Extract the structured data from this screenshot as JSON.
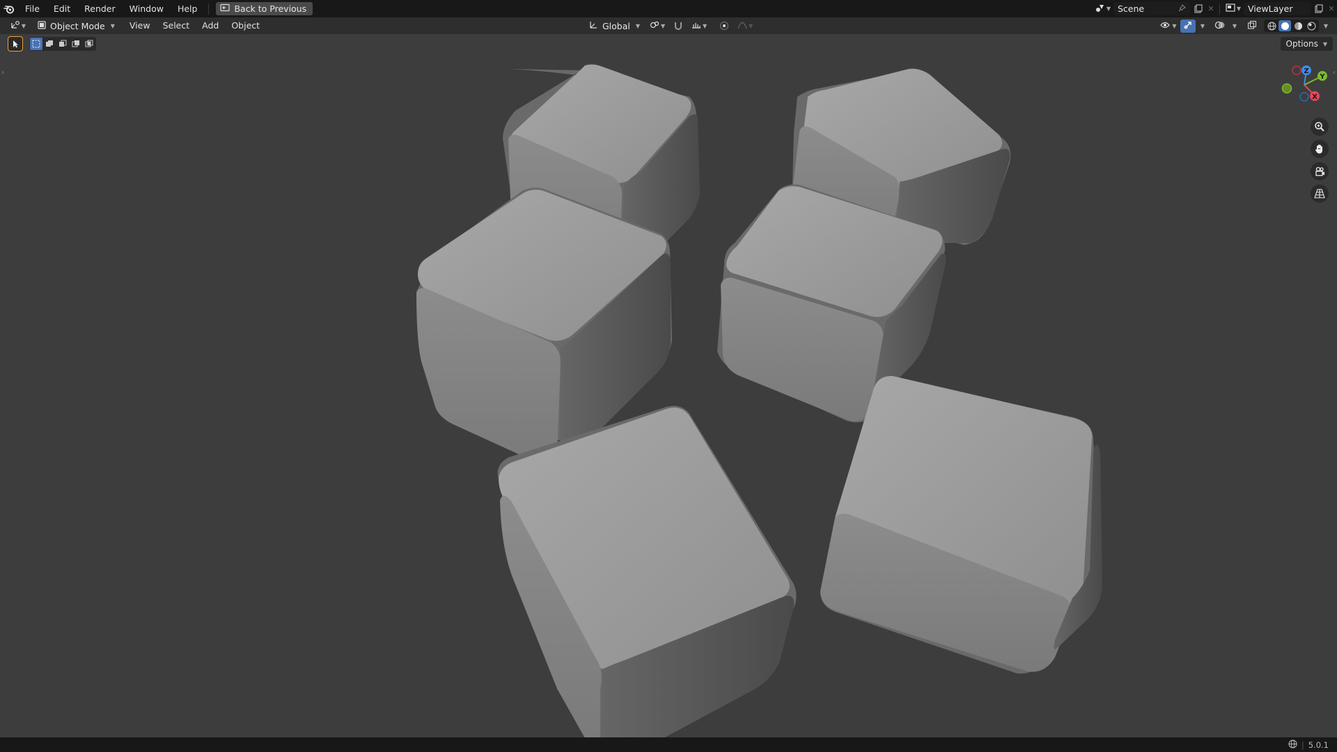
{
  "menu": {
    "file": "File",
    "edit": "Edit",
    "render": "Render",
    "window": "Window",
    "help": "Help",
    "back_button": "Back to Previous"
  },
  "scene": {
    "name": "Scene"
  },
  "view_layer": {
    "name": "ViewLayer"
  },
  "header": {
    "mode": "Object Mode",
    "view": "View",
    "select": "Select",
    "add": "Add",
    "object": "Object",
    "transform_orientation": "Global",
    "options": "Options"
  },
  "gizmo": {
    "z": "Z",
    "y": "Y",
    "x": "X"
  },
  "status": {
    "version": "5.0.1"
  },
  "colors": {
    "accent": "#4772b3",
    "axis_x": "#e8455a",
    "axis_y": "#7bbd2b",
    "axis_z": "#3d8de8",
    "viewport_bg": "#3d3d3d"
  }
}
